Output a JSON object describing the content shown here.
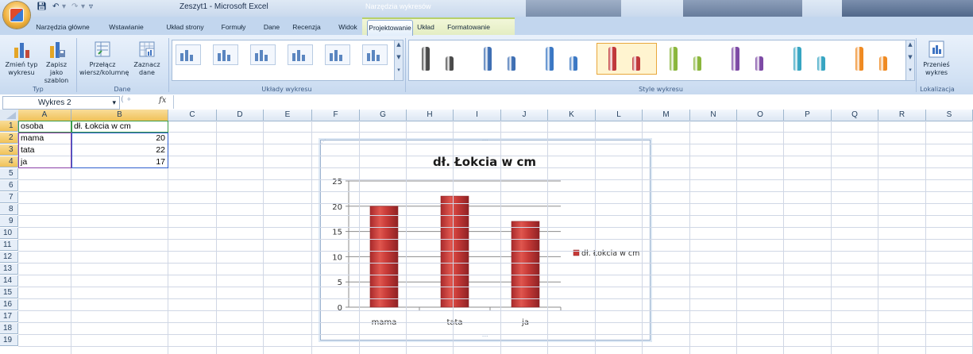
{
  "window": {
    "title": "Zeszyt1 - Microsoft Excel",
    "context_title": "Narzędzia wykresów"
  },
  "tabs": [
    "Narzędzia główne",
    "Wstawianie",
    "Układ strony",
    "Formuły",
    "Dane",
    "Recenzja",
    "Widok",
    "Projektowanie",
    "Układ",
    "Formatowanie"
  ],
  "active_tab": "Projektowanie",
  "ribbon": {
    "type_group": {
      "label": "Typ",
      "change_type": "Zmień typ wykresu",
      "save_template": "Zapisz jako szablon"
    },
    "data_group": {
      "label": "Dane",
      "switch_row_col": "Przełącz wiersz/kolumnę",
      "select_data": "Zaznacz dane"
    },
    "layouts_group": {
      "label": "Układy wykresu"
    },
    "styles_group": {
      "label": "Style wykresu",
      "colors": [
        "#4a4a4a",
        "#3f6fb3",
        "#3b78c4",
        "#c0383a",
        "#8ab63c",
        "#7d4aa5",
        "#37a5c2",
        "#ef8a22"
      ]
    },
    "location_group": {
      "label": "Lokalizacja",
      "move_chart": "Przenieś wykres"
    }
  },
  "formula_bar": {
    "name_box": "Wykres 2",
    "fx": "fx"
  },
  "sheet": {
    "columns": [
      "A",
      "B",
      "C",
      "D",
      "E",
      "F",
      "G",
      "H",
      "I",
      "J",
      "K",
      "L",
      "M",
      "N",
      "O",
      "P",
      "Q",
      "R",
      "S"
    ],
    "rows": [
      "1",
      "2",
      "3",
      "4",
      "5",
      "6",
      "7",
      "8",
      "9",
      "10",
      "11",
      "12",
      "13",
      "14",
      "15",
      "16",
      "17",
      "18",
      "19"
    ],
    "cells": {
      "A1": "osoba",
      "B1": "dł. Łokcia w cm",
      "A2": "mama",
      "B2": "20",
      "A3": "tata",
      "B3": "22",
      "A4": "ja",
      "B4": "17"
    }
  },
  "chart_data": {
    "type": "bar",
    "title": "dł. Łokcia w cm",
    "categories": [
      "mama",
      "tata",
      "ja"
    ],
    "series": [
      {
        "name": "dł. Łokcia w cm",
        "values": [
          20,
          22,
          17
        ],
        "color": "#c0383a"
      }
    ],
    "ylim": [
      0,
      25
    ],
    "yticks": [
      0,
      5,
      10,
      15,
      20,
      25
    ],
    "grid": true,
    "legend": "right"
  }
}
